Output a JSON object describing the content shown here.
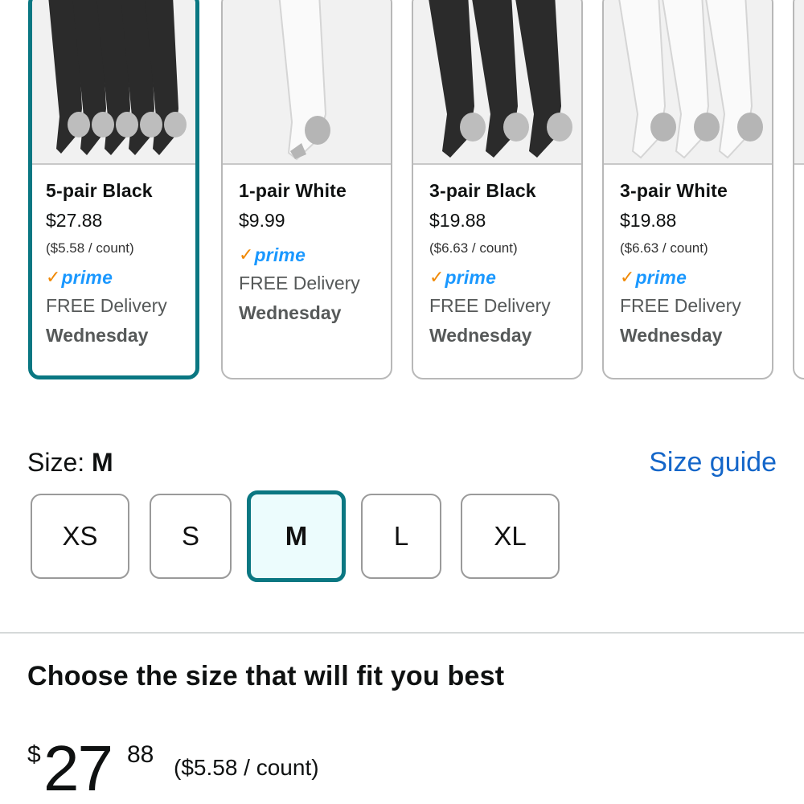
{
  "variants": [
    {
      "title": "5-pair Black",
      "price": "$27.88",
      "unit_price": "($5.58 / count)",
      "prime": "prime",
      "delivery": "FREE Delivery",
      "day": "Wednesday",
      "sock_color": "#2b2b2b",
      "selected": true
    },
    {
      "title": "1-pair White",
      "price": "$9.99",
      "unit_price": "",
      "prime": "prime",
      "delivery": "FREE Delivery",
      "day": "Wednesday",
      "sock_color": "#fafafa",
      "selected": false
    },
    {
      "title": "3-pair Black",
      "price": "$19.88",
      "unit_price": "($6.63 / count)",
      "prime": "prime",
      "delivery": "FREE Delivery",
      "day": "Wednesday",
      "sock_color": "#2b2b2b",
      "selected": false
    },
    {
      "title": "3-pair White",
      "price": "$19.88",
      "unit_price": "($6.63 / count)",
      "prime": "prime",
      "delivery": "FREE Delivery",
      "day": "Wednesday",
      "sock_color": "#fafafa",
      "selected": false
    }
  ],
  "prime_check": "✓",
  "size": {
    "label": "Size: ",
    "selected": "M",
    "guide": "Size guide",
    "options": [
      "XS",
      "S",
      "M",
      "L",
      "XL"
    ]
  },
  "choose_text": "Choose the size that will fit you best",
  "price": {
    "symbol": "$",
    "whole": "27",
    "fraction": "88",
    "unit": "($5.58 / count)"
  },
  "colors": {
    "accent": "#0a7782",
    "prime_blue": "#1a98ff",
    "prime_check": "#f08804",
    "link": "#1466c9"
  }
}
